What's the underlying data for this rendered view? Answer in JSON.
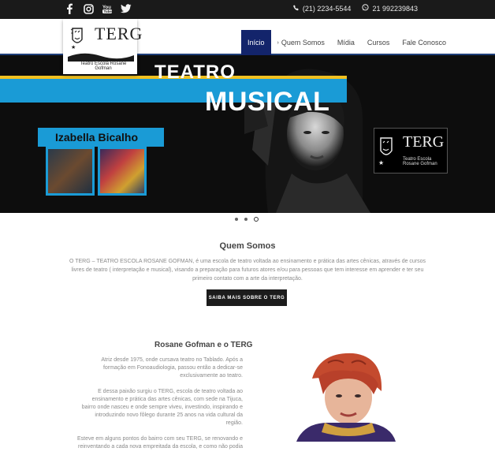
{
  "topbar": {
    "social": [
      "facebook-icon",
      "instagram-icon",
      "youtube-icon",
      "twitter-icon"
    ],
    "phone": "(21) 2234-5544",
    "whatsapp": "21 992239843"
  },
  "logo": {
    "name": "TERG",
    "subtitle": "Teatro Escola Rosane Gofman"
  },
  "nav": {
    "items": [
      "Início",
      "Quem Somos",
      "Mídia",
      "Cursos",
      "Fale Conosco"
    ],
    "active_index": 0
  },
  "hero": {
    "line1": "TEATRO",
    "line2": "MUSICAL",
    "name_tag": "Izabella Bicalho",
    "logo_name": "TERG",
    "logo_sub": "Teatro Escola Rosane Gofman",
    "slides": 3,
    "active_slide": 2
  },
  "about": {
    "title": "Quem Somos",
    "text": "O TERG – TEATRO ESCOLA ROSANE GOFMAN, é uma escola de teatro voltada ao ensinamento e prática das artes cênicas, através de cursos livres de teatro ( interpretação e musical), visando a preparação para futuros atores e/ou para pessoas que tem interesse em aprender e ter seu primeiro contato com a arte da interpretação.",
    "button": "SAIBA MAIS SOBRE O TERG"
  },
  "rg": {
    "title": "Rosane Gofman e o TERG",
    "paragraphs": [
      "Atriz desde 1975, onde cursava teatro no Tablado. Após a formação em Fonoaudiologia, passou então a dedicar-se exclusivamente ao teatro.",
      "E dessa paixão surgiu o TERG, escola de teatro voltada ao ensinamento e prática das artes cênicas, com sede na Tijuca, bairro onde nasceu e onde sempre viveu, investindo, inspirando e introduzindo novo fôlego durante 25 anos na vida cultural da região.",
      "Esteve em alguns pontos do bairro com seu TERG, se renovando e reinventando a cada nova empreitada da escola, e como não podia"
    ]
  },
  "colors": {
    "topbar": "#1a1a1a",
    "nav_active": "#13246b",
    "accent_blue": "#1a9bd6",
    "accent_yellow": "#f0c020"
  }
}
